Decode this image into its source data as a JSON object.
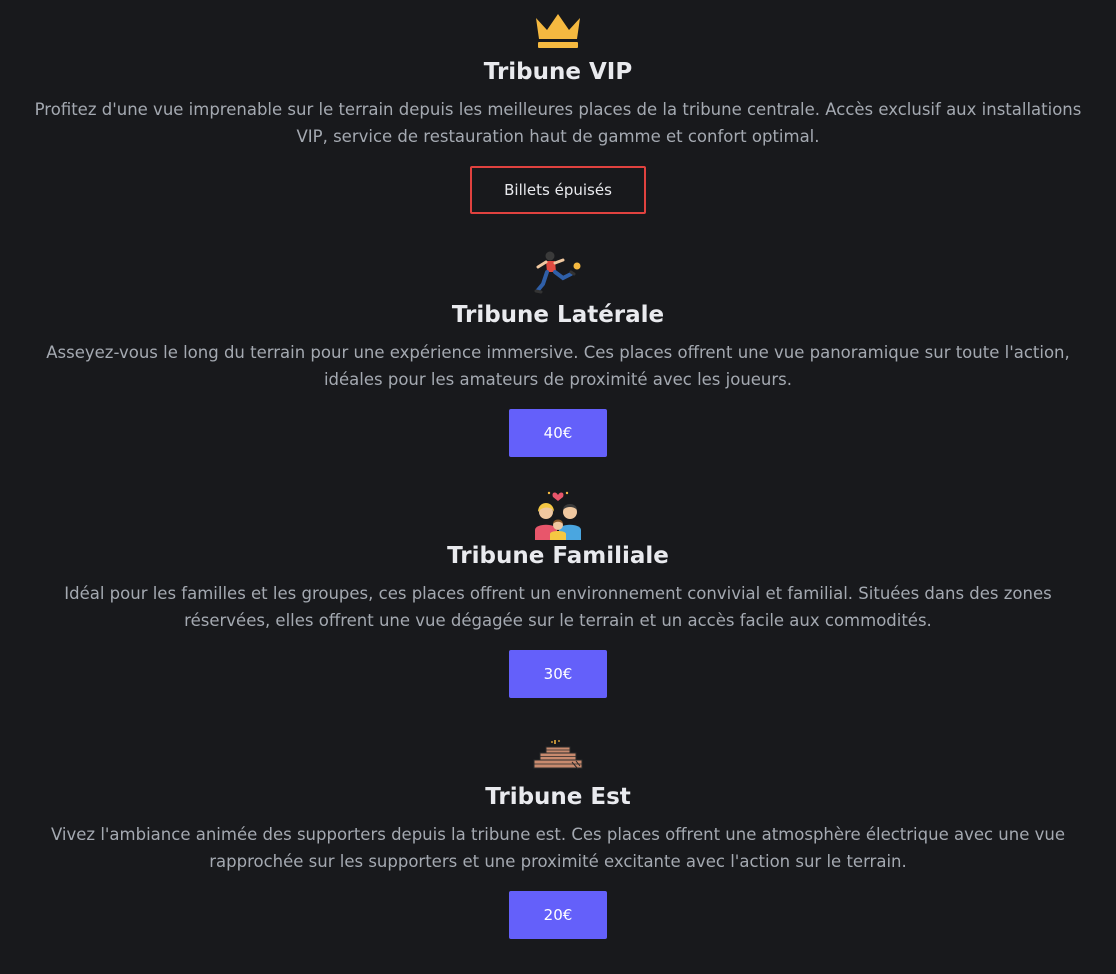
{
  "sections": [
    {
      "icon": "crown-icon",
      "title": "Tribune VIP",
      "description": "Profitez d'une vue imprenable sur le terrain depuis les meilleures places de la tribune centrale. Accès exclusif aux installations VIP, service de restauration haut de gamme et confort optimal.",
      "button": "Billets épuisés",
      "button_color": "#e0423f"
    },
    {
      "icon": "football-player-icon",
      "title": "Tribune Latérale",
      "description": "Asseyez-vous le long du terrain pour une expérience immersive. Ces places offrent une vue panoramique sur toute l'action, idéales pour les amateurs de proximité avec les joueurs.",
      "button": "40€",
      "button_color": "#6460fa"
    },
    {
      "icon": "family-icon",
      "title": "Tribune Familiale",
      "description": "Idéal pour les familles et les groupes, ces places offrent un environnement convivial et familial. Situées dans des zones réservées, elles offrent une vue dégagée sur le terrain et un accès facile aux commodités.",
      "button": "30€",
      "button_color": "#6460fa"
    },
    {
      "icon": "stadium-stands-icon",
      "title": "Tribune Est",
      "description": "Vivez l'ambiance animée des supporters depuis la tribune est. Ces places offrent une atmosphère électrique avec une vue rapprochée sur les supporters et une proximité excitante avec l'action sur le terrain.",
      "button": "20€",
      "button_color": "#6460fa"
    }
  ]
}
